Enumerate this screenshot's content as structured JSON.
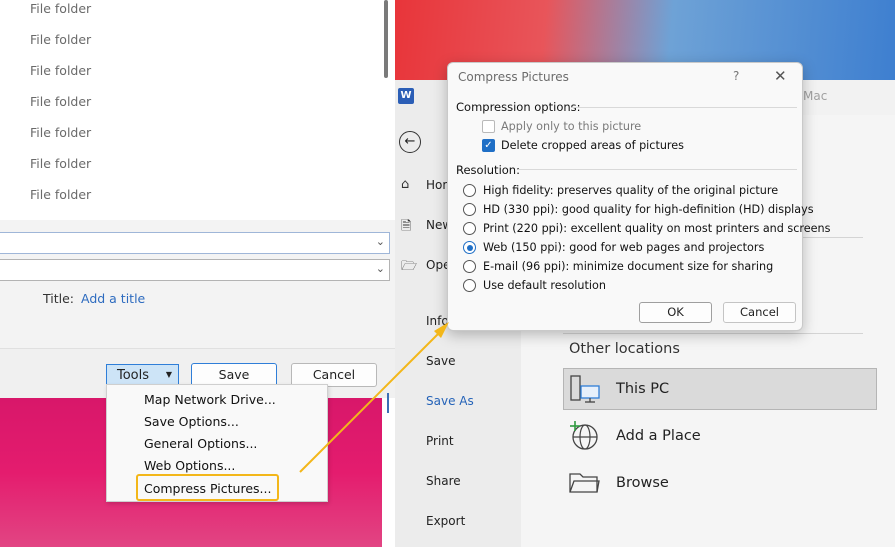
{
  "file_list": {
    "rows": [
      "File folder",
      "File folder",
      "File folder",
      "File folder",
      "File folder",
      "File folder",
      "File folder"
    ]
  },
  "save_dialog": {
    "title_label": "Title:",
    "title_link": "Add a title",
    "tools_label": "Tools",
    "save_label": "Save",
    "cancel_label": "Cancel"
  },
  "tools_menu": {
    "items": [
      "Map Network Drive...",
      "Save Options...",
      "General Options...",
      "Web Options...",
      "Compress Pictures..."
    ]
  },
  "word": {
    "logo": "W",
    "mac_text": "Mac",
    "nav": {
      "home": "Hom",
      "new": "New",
      "open": "Ope",
      "info": "Info",
      "save": "Save",
      "save_as": "Save As",
      "print": "Print",
      "share": "Share",
      "export": "Export"
    },
    "other_locations": "Other locations",
    "locations": [
      "This PC",
      "Add a Place",
      "Browse"
    ]
  },
  "compress_dialog": {
    "title": "Compress Pictures",
    "help": "?",
    "close": "✕",
    "compression_heading": "Compression options:",
    "apply_only": "Apply only to this picture",
    "delete_cropped": "Delete cropped areas of pictures",
    "resolution_heading": "Resolution:",
    "options": [
      "High fidelity: preserves quality of the original picture",
      "HD (330 ppi): good quality for high-definition (HD) displays",
      "Print (220 ppi): excellent quality on most printers and screens",
      "Web (150 ppi): good for web pages and projectors",
      "E-mail (96 ppi): minimize document size for sharing",
      "Use default resolution"
    ],
    "selected_option": "Web (150 ppi): good for web pages and projectors",
    "apply_only_checked": false,
    "delete_cropped_checked": true,
    "ok_label": "OK",
    "cancel_label": "Cancel"
  },
  "colors": {
    "accent": "#1f6fc6",
    "highlight": "#f3b71a",
    "link": "#2d6bbf"
  }
}
